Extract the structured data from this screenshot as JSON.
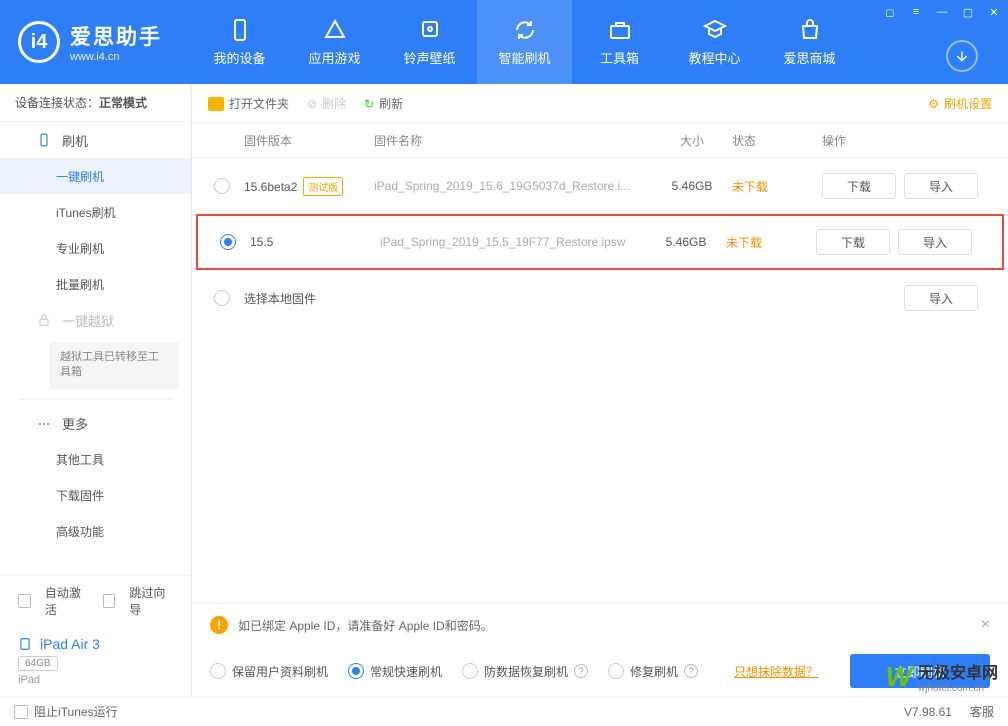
{
  "header": {
    "app_name": "爱思助手",
    "app_url": "www.i4.cn",
    "tabs": [
      "我的设备",
      "应用游戏",
      "铃声壁纸",
      "智能刷机",
      "工具箱",
      "教程中心",
      "爱思商城"
    ]
  },
  "sidebar": {
    "status_label": "设备连接状态：",
    "status_value": "正常模式",
    "flash_group": "刷机",
    "items": [
      "一键刷机",
      "iTunes刷机",
      "专业刷机",
      "批量刷机"
    ],
    "jailbreak": "一键越狱",
    "jailbreak_note": "越狱工具已转移至工具箱",
    "more_group": "更多",
    "more_items": [
      "其他工具",
      "下载固件",
      "高级功能"
    ],
    "auto_activate": "自动激活",
    "skip_guide": "跳过向导",
    "device_name": "iPad Air 3",
    "device_capacity": "64GB",
    "device_type": "iPad"
  },
  "toolbar": {
    "open_folder": "打开文件夹",
    "delete": "删除",
    "refresh": "刷新",
    "settings": "刷机设置"
  },
  "table": {
    "headers": {
      "version": "固件版本",
      "name": "固件名称",
      "size": "大小",
      "status": "状态",
      "ops": "操作"
    },
    "rows": [
      {
        "version": "15.6beta2",
        "test_tag": "测试版",
        "name": "iPad_Spring_2019_15.6_19G5037d_Restore.i...",
        "size": "5.46GB",
        "status": "未下载",
        "btn1": "下载",
        "btn2": "导入",
        "selected": false
      },
      {
        "version": "15.5",
        "test_tag": "",
        "name": "iPad_Spring_2019_15.5_19F77_Restore.ipsw",
        "size": "5.46GB",
        "status": "未下载",
        "btn1": "下载",
        "btn2": "导入",
        "selected": true
      },
      {
        "version": "选择本地固件",
        "test_tag": "",
        "name": "",
        "size": "",
        "status": "",
        "btn1": "",
        "btn2": "导入",
        "selected": false
      }
    ]
  },
  "bottom": {
    "notice": "如已绑定 Apple ID，请准备好 Apple ID和密码。",
    "opts": [
      "保留用户资料刷机",
      "常规快速刷机",
      "防数据恢复刷机",
      "修复刷机"
    ],
    "link": "只想抹除数据？",
    "flash_btn": "立即刷机"
  },
  "footer": {
    "prevent_itunes": "阻止iTunes运行",
    "version": "V7.98.61",
    "service": "客服"
  },
  "watermark": {
    "zh": "无极安卓网",
    "en": "wjhotel.com.cn"
  }
}
